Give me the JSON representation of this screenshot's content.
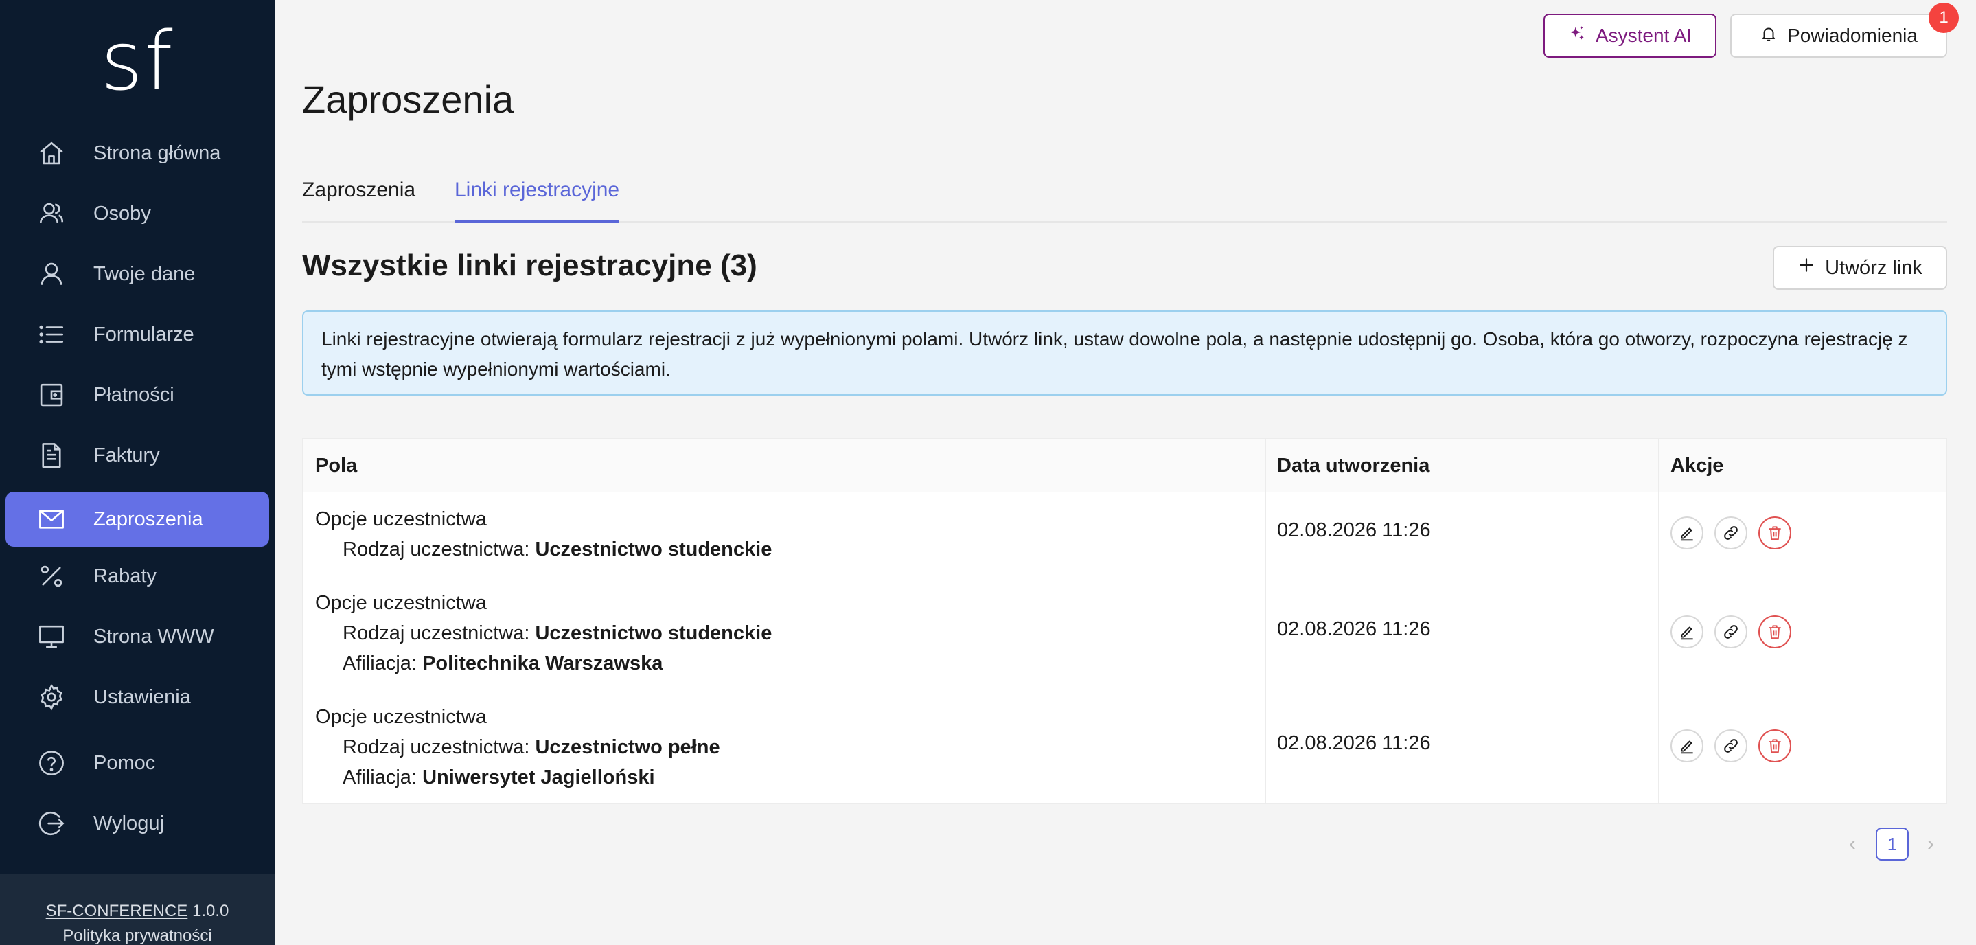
{
  "app": {
    "logo_text": "sf"
  },
  "sidebar": {
    "items": [
      {
        "label": "Strona główna",
        "icon": "home-icon"
      },
      {
        "label": "Osoby",
        "icon": "users-icon"
      },
      {
        "label": "Twoje dane",
        "icon": "user-icon"
      },
      {
        "label": "Formularze",
        "icon": "list-icon"
      },
      {
        "label": "Płatności",
        "icon": "wallet-icon"
      },
      {
        "label": "Faktury",
        "icon": "document-icon"
      },
      {
        "label": "Zaproszenia",
        "icon": "mail-icon",
        "active": true
      },
      {
        "label": "Rabaty",
        "icon": "percent-icon"
      },
      {
        "label": "Strona WWW",
        "icon": "monitor-icon"
      },
      {
        "label": "Ustawienia",
        "icon": "gear-icon"
      },
      {
        "label": "Pomoc",
        "icon": "help-icon"
      },
      {
        "label": "Wyloguj",
        "icon": "logout-icon"
      }
    ],
    "footer": {
      "product": "SF-CONFERENCE",
      "version": "1.0.0",
      "privacy": "Polityka prywatności"
    }
  },
  "topbar": {
    "ai_label": "Asystent AI",
    "notifications_label": "Powiadomienia",
    "notifications_count": "1"
  },
  "page": {
    "title": "Zaproszenia"
  },
  "tabs": [
    {
      "label": "Zaproszenia"
    },
    {
      "label": "Linki rejestracyjne",
      "active": true
    }
  ],
  "section": {
    "title": "Wszystkie linki rejestracyjne (3)",
    "create_label": "Utwórz link",
    "info": "Linki rejestracyjne otwierają formularz rejestracji z już wypełnionymi polami. Utwórz link, ustaw dowolne pola, a następnie udostępnij go. Osoba, która go otworzy, rozpoczyna rejestrację z tymi wstępnie wypełnionymi wartościami."
  },
  "table": {
    "headers": {
      "fields": "Pola",
      "created": "Data utworzenia",
      "actions": "Akcje"
    },
    "rows": [
      {
        "group": "Opcje uczestnictwa",
        "fields": [
          {
            "label": "Rodzaj uczestnictwa:",
            "value": "Uczestnictwo studenckie"
          }
        ],
        "created": "02.08.2026 11:26"
      },
      {
        "group": "Opcje uczestnictwa",
        "fields": [
          {
            "label": "Rodzaj uczestnictwa:",
            "value": "Uczestnictwo studenckie"
          },
          {
            "label": "Afiliacja:",
            "value": "Politechnika Warszawska"
          }
        ],
        "created": "02.08.2026 11:26"
      },
      {
        "group": "Opcje uczestnictwa",
        "fields": [
          {
            "label": "Rodzaj uczestnictwa:",
            "value": "Uczestnictwo pełne"
          },
          {
            "label": "Afiliacja:",
            "value": "Uniwersytet Jagielloński"
          }
        ],
        "created": "02.08.2026 11:26"
      }
    ]
  },
  "pagination": {
    "current": "1",
    "prev": "‹",
    "next": "›"
  },
  "colors": {
    "sidebar_bg": "#0c1b2e",
    "active_nav": "#6470e6",
    "accent": "#5a66d8",
    "ai_purple": "#7d1a7e",
    "danger": "#e05252",
    "info_bg": "#e4f2fc"
  }
}
